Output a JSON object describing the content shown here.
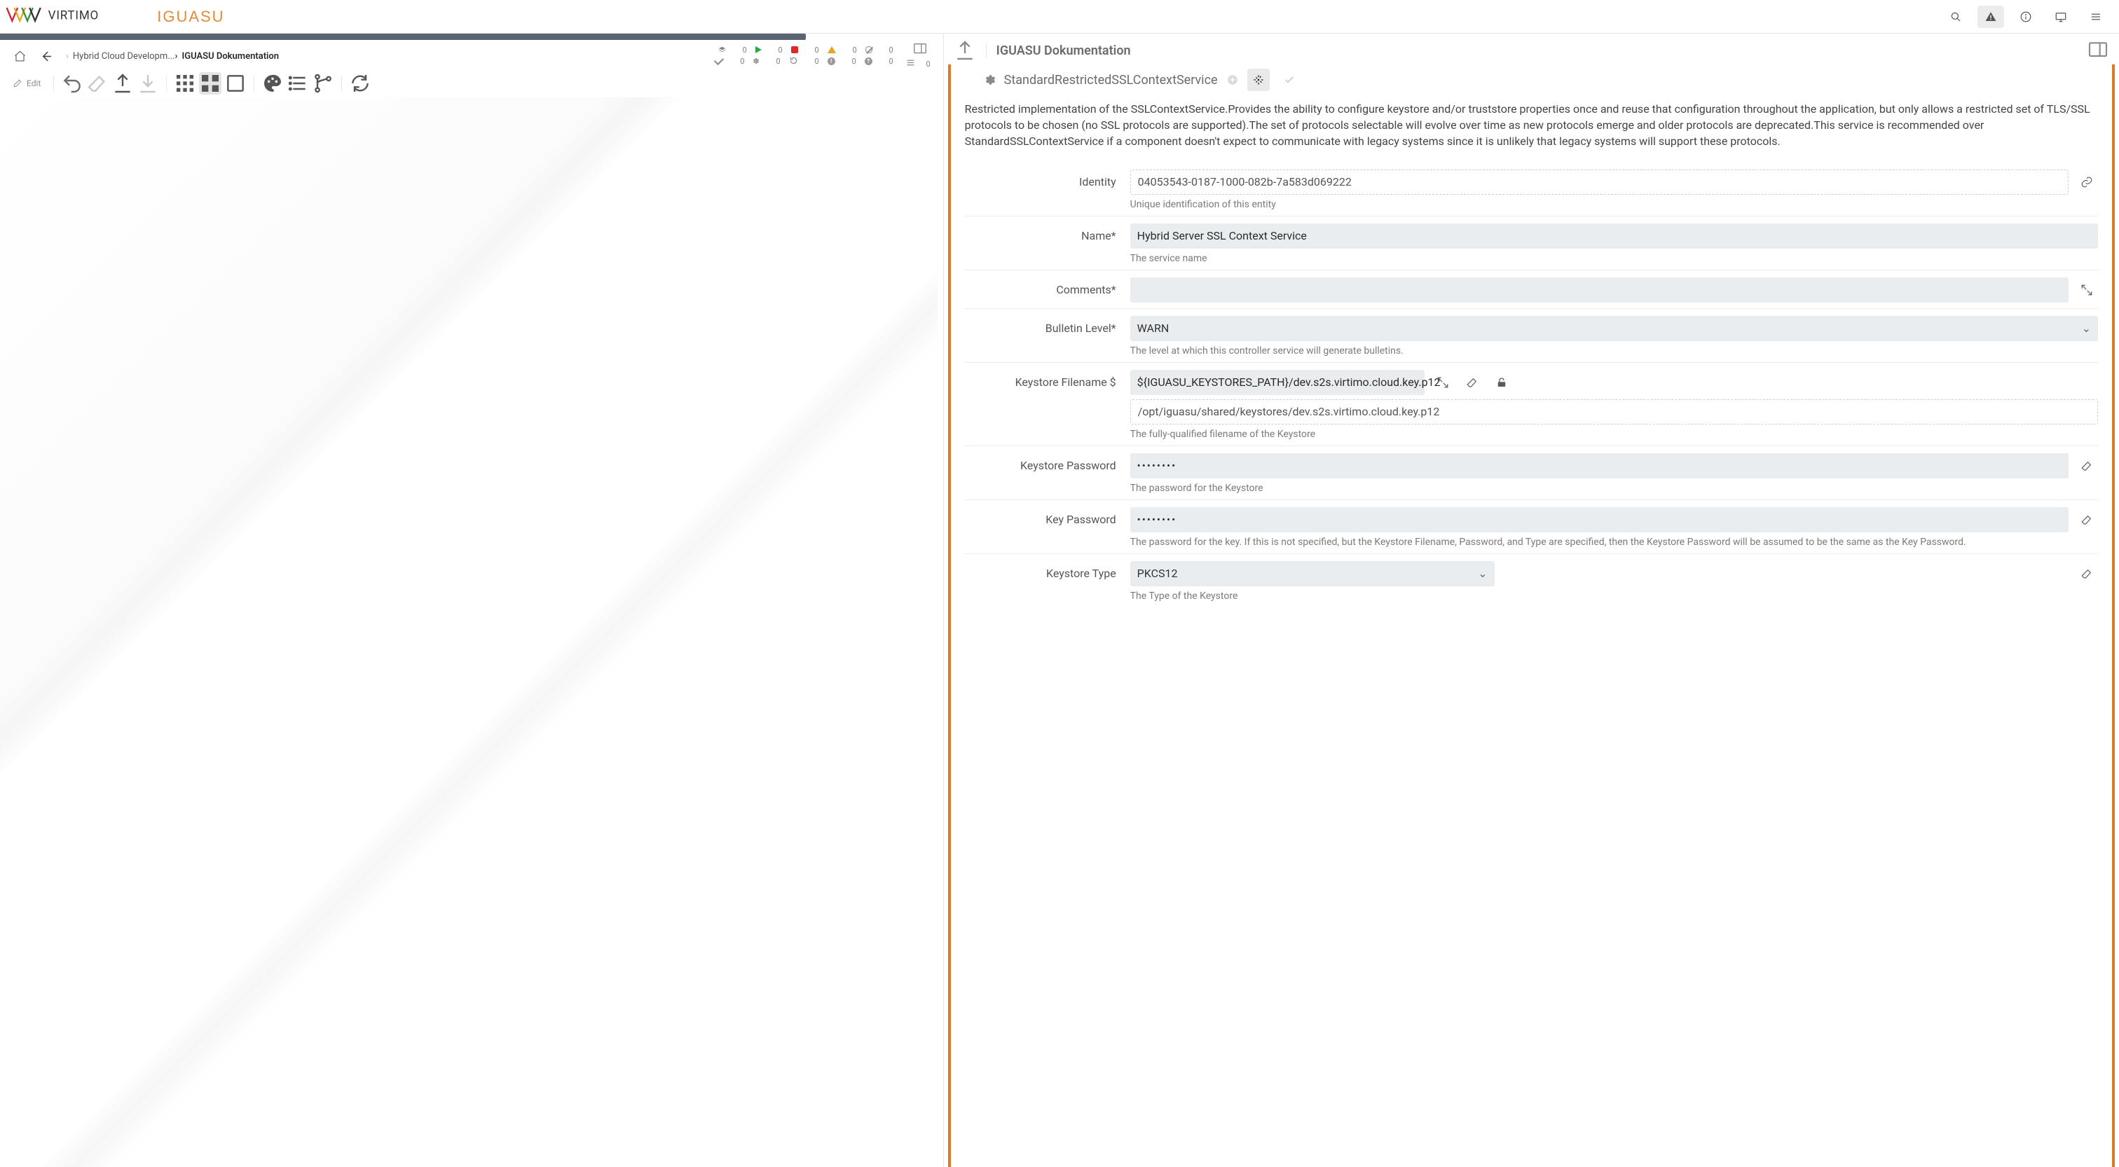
{
  "header": {
    "product": "IGUASU"
  },
  "breadcrumbs": {
    "items": [
      {
        "label": "Hybrid Cloud Developm..."
      },
      {
        "label": "IGUASU Dokumentation"
      }
    ]
  },
  "status": {
    "layers": "0",
    "running": "0",
    "stopped": "0",
    "alerts": "0",
    "disabled": "0",
    "queued": "0",
    "valid": "0",
    "magic": "0",
    "refresh": "0",
    "warn": "0",
    "unknown": "0"
  },
  "toolbar": {
    "edit_label": "Edit"
  },
  "right": {
    "title": "IGUASU Dokumentation",
    "service_name": "StandardRestrictedSSLContextService",
    "description": "Restricted implementation of the SSLContextService.Provides the ability to configure keystore and/or truststore properties once and reuse that configuration throughout the application, but only allows a restricted set of TLS/SSL protocols to be chosen (no SSL protocols are supported).The set of protocols selectable will evolve over time as new protocols emerge and older protocols are deprecated.This service is recommended over StandardSSLContextService if a component doesn't expect to communicate with legacy systems since it is unlikely that legacy systems will support these protocols."
  },
  "form": {
    "identity": {
      "label": "Identity",
      "value": "04053543-0187-1000-082b-7a583d069222",
      "hint": "Unique identification of this entity"
    },
    "name": {
      "label": "Name",
      "value": "Hybrid Server SSL Context Service",
      "hint": "The service name"
    },
    "comments": {
      "label": "Comments",
      "value": ""
    },
    "bulletin": {
      "label": "Bulletin Level",
      "value": "WARN",
      "hint": "The level at which this controller service will generate bulletins."
    },
    "keystore_file": {
      "label": "Keystore Filename $",
      "expr": "${IGUASU_KEYSTORES_PATH}/dev.s2s.virtimo.cloud.key.p12",
      "resolved": "/opt/iguasu/shared/keystores/dev.s2s.virtimo.cloud.key.p12",
      "hint": "The fully-qualified filename of the Keystore"
    },
    "keystore_pw": {
      "label": "Keystore Password",
      "hint": "The password for the Keystore"
    },
    "key_pw": {
      "label": "Key Password",
      "hint": "The password for the key. If this is not specified, but the Keystore Filename, Password, and Type are specified, then the Keystore Password will be assumed to be the same as the Key Password."
    },
    "keystore_type": {
      "label": "Keystore Type",
      "value": "PKCS12",
      "hint": "The Type of the Keystore"
    }
  }
}
